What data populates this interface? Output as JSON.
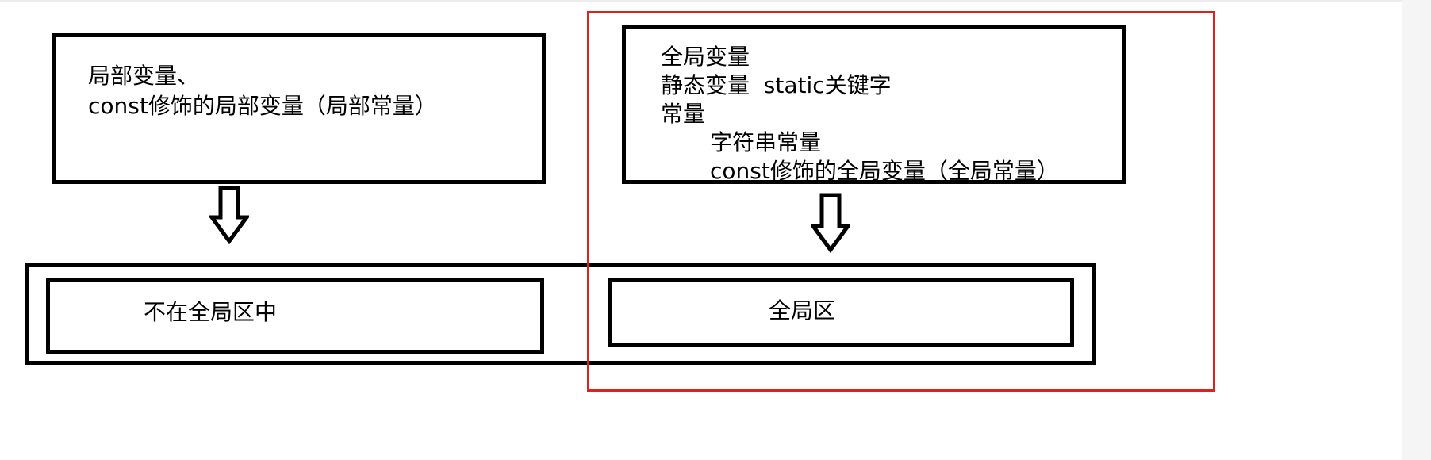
{
  "local_box": {
    "line1": "局部变量、",
    "line2": "const修饰的局部变量（局部常量）"
  },
  "global_box": {
    "line1": "全局变量",
    "line2": "静态变量  static关键字",
    "line3": "常量",
    "line4": "字符串常量",
    "line5": "const修饰的全局变量（全局常量）"
  },
  "bottom_left_label": "不在全局区中",
  "bottom_right_label": "全局区",
  "colors": {
    "box_border": "#000000",
    "highlight_border": "#d9231c"
  },
  "icons": {
    "arrow_left": "down-arrow-icon",
    "arrow_right": "down-arrow-icon"
  }
}
